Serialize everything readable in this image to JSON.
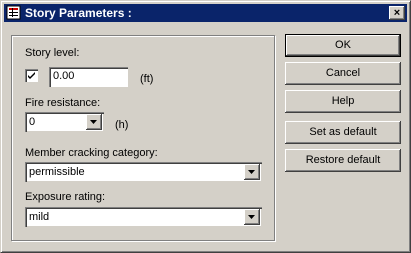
{
  "window": {
    "title": "Story Parameters :",
    "close_glyph": "×"
  },
  "story_level": {
    "label": "Story level:",
    "checked": true,
    "value": "0.00",
    "unit": "(ft)"
  },
  "fire_resistance": {
    "label": "Fire resistance:",
    "value": "0",
    "unit": "(h)"
  },
  "member_cracking": {
    "label": "Member cracking category:",
    "value": "permissible"
  },
  "exposure": {
    "label": "Exposure rating:",
    "value": "mild"
  },
  "buttons": {
    "ok": "OK",
    "cancel": "Cancel",
    "help": "Help",
    "set_default": "Set as default",
    "restore_default": "Restore default"
  }
}
